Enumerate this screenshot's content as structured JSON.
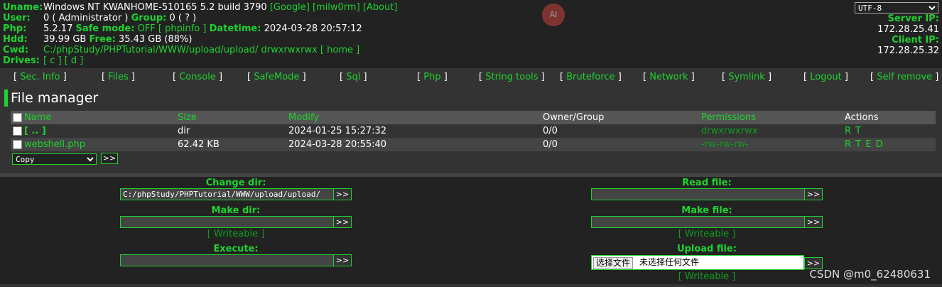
{
  "header": {
    "uname_label": "Uname:",
    "uname_value": "Windows NT KWANHOME-510165 5.2 build 3790",
    "google_link": "[Google]",
    "milw0rm_link": "[milw0rm]",
    "about_link": "[About]",
    "user_label": "User:",
    "user_value": "0 ( Administrator )",
    "group_label": "Group:",
    "group_value": "0 ( ? )",
    "php_label": "Php:",
    "php_value": "5.2.17",
    "safemode_label": "Safe mode:",
    "safemode_value": "OFF",
    "phpinfo_link": "[ phpinfo ]",
    "datetime_label": "Datetime:",
    "datetime_value": "2024-03-28 20:57:12",
    "hdd_label": "Hdd:",
    "hdd_value": "39.99 GB",
    "free_label": "Free:",
    "free_value": "35.43 GB (88%)",
    "cwd_label": "Cwd:",
    "cwd_value": "C:/phpStudy/PHPTutorial/WWW/upload/upload/",
    "cwd_perms": "drwxrwxrwx",
    "home_link": "[ home ]",
    "drives_label": "Drives:",
    "drive_c": "[ c ]",
    "drive_d": "[ d ]",
    "charset": "UTF-8",
    "server_ip_label": "Server IP:",
    "server_ip": "172.28.25.41",
    "client_ip_label": "Client IP:",
    "client_ip": "172.28.25.32",
    "ai_badge": "AI"
  },
  "menu": [
    {
      "label": "Sec. Info"
    },
    {
      "label": "Files"
    },
    {
      "label": "Console"
    },
    {
      "label": "SafeMode"
    },
    {
      "label": "Sql"
    },
    {
      "label": "Php"
    },
    {
      "label": "String tools"
    },
    {
      "label": "Bruteforce"
    },
    {
      "label": "Network"
    },
    {
      "label": "Symlink"
    },
    {
      "label": "Logout"
    },
    {
      "label": "Self remove"
    }
  ],
  "file_manager": {
    "title": "File manager",
    "columns": {
      "name": "Name",
      "size": "Size",
      "modify": "Modify",
      "owner": "Owner/Group",
      "permissions": "Permissions",
      "actions": "Actions"
    },
    "rows": [
      {
        "name": "[ .. ]",
        "size": "dir",
        "modify": "2024-01-25 15:27:32",
        "owner": "0/0",
        "perms": "drwxrwxrwx",
        "actions": "R T"
      },
      {
        "name": "webshell.php",
        "size": "62.42 KB",
        "modify": "2024-03-28 20:55:40",
        "owner": "0/0",
        "perms": "-rw-rw-rw-",
        "actions": "R T E D"
      }
    ],
    "action_select": "Copy",
    "go_label": ">>"
  },
  "forms": {
    "change_dir_label": "Change dir:",
    "change_dir_value": "C:/phpStudy/PHPTutorial/WWW/upload/upload/",
    "make_dir_label": "Make dir:",
    "make_dir_value": "",
    "writeable1": "[ Writeable ]",
    "execute_label": "Execute:",
    "execute_value": "",
    "read_file_label": "Read file:",
    "read_file_value": "",
    "make_file_label": "Make file:",
    "make_file_value": "",
    "writeable2": "[ Writeable ]",
    "upload_label": "Upload file:",
    "choose_file": "选择文件",
    "no_file": "未选择任何文件",
    "writeable3": "[ Writeable ]",
    "go_label": ">>"
  },
  "watermark": "CSDN @m0_62480631"
}
